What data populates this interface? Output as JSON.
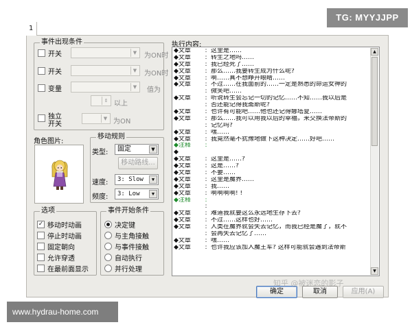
{
  "tabs": [
    "1"
  ],
  "conditions": {
    "title": "事件出现条件",
    "switch1": {
      "label": "开关",
      "suffix": "为ON时"
    },
    "switch2": {
      "label": "开关",
      "suffix": "为ON时"
    },
    "variable": {
      "label": "变量",
      "suffix": "值为",
      "above": "以上"
    },
    "selfswitch": {
      "label_line1": "独立",
      "label_line2": "开关",
      "suffix": "为ON"
    }
  },
  "avatar": {
    "label": "角色图片:"
  },
  "movement": {
    "title": "移动规则",
    "type_label": "类型:",
    "type_value": "固定",
    "route_button": "移动路线...",
    "speed_label": "速度:",
    "speed_value": "3: Slow",
    "freq_label": "频度:",
    "freq_value": "3: Low"
  },
  "options": {
    "title": "选项",
    "items": [
      {
        "label": "移动时动画",
        "checked": "✓"
      },
      {
        "label": "停止时动画",
        "checked": ""
      },
      {
        "label": "固定朝向",
        "checked": ""
      },
      {
        "label": "允许穿透",
        "checked": ""
      },
      {
        "label": "在最前面显示",
        "checked": ""
      }
    ]
  },
  "trigger": {
    "title": "事件开始条件",
    "items": [
      {
        "label": "决定键",
        "selected": true
      },
      {
        "label": "与主角接触",
        "selected": false
      },
      {
        "label": "与事件接触",
        "selected": false
      },
      {
        "label": "自动执行",
        "selected": false
      },
      {
        "label": "并行处理",
        "selected": false
      }
    ]
  },
  "exec": {
    "title": "执行内容:",
    "lines": [
      {
        "kw": "◆文章",
        "sep": ":",
        "text": "这里是……"
      },
      {
        "kw": "◆文章",
        "sep": ":",
        "text": "转生之地吗……"
      },
      {
        "kw": "◆文章",
        "sep": ":",
        "text": "我已经死了……"
      },
      {
        "kw": "◆文章",
        "sep": ":",
        "text": "那么……我要转生成为什么呢?"
      },
      {
        "kw": "◆文章",
        "sep": ":",
        "text": "啊……真不想睁开眼睛……"
      },
      {
        "kw": "◆文章",
        "sep": ":",
        "text": "不过……在我面前的……一定是熟悉的命运女神的"
      },
      {
        "kw": "",
        "sep": ":",
        "text": "微笑吧……",
        "cont": true
      },
      {
        "kw": "◆文章",
        "sep": ":",
        "text": "听说转生会忘记一切的记忆……不知……我以后是"
      },
      {
        "kw": "",
        "sep": ":",
        "text": "否还能记得我斋斯呢?",
        "cont": true
      },
      {
        "kw": "◆文章",
        "sep": ":",
        "text": "也许有可能吧……他也还记得娜塔夏……"
      },
      {
        "kw": "◆文章",
        "sep": ":",
        "text": "那么……我可以用我以后的幸福，来交换法帝斯的"
      },
      {
        "kw": "",
        "sep": ":",
        "text": "记忆吗?",
        "cont": true
      },
      {
        "kw": "◆文章",
        "sep": ":",
        "text": "嘿……"
      },
      {
        "kw": "◆文章",
        "sep": ":",
        "text": "我竟然毫不犹豫地做下这种决定……好吧……"
      },
      {
        "kw": "◆注释",
        "sep": ":",
        "text": "",
        "note": true
      },
      {
        "kw": "◆",
        "sep": "",
        "text": "",
        "empty": true
      },
      {
        "kw": "◆文章",
        "sep": ":",
        "text": "这里是……?"
      },
      {
        "kw": "◆文章",
        "sep": ":",
        "text": "这是……?"
      },
      {
        "kw": "◆文章",
        "sep": ":",
        "text": "不要……"
      },
      {
        "kw": "◆文章",
        "sep": ":",
        "text": "这里是魔界……"
      },
      {
        "kw": "◆文章",
        "sep": ":",
        "text": "我……"
      },
      {
        "kw": "◆文章",
        "sep": ":",
        "text": "啊啊啊啊! !"
      },
      {
        "kw": "◆注释",
        "sep": ":",
        "text": "",
        "note": true
      },
      {
        "kw": "",
        "sep": ":",
        "text": "",
        "cont": true
      },
      {
        "kw": "◆文章",
        "sep": ":",
        "text": "难道我就要这么永远地生存下去?"
      },
      {
        "kw": "◆文章",
        "sep": ":",
        "text": "不过……这样也好……"
      },
      {
        "kw": "◆文章",
        "sep": ":",
        "text": "人类在魔界就会失去记忆，而我已经是魔了，就不"
      },
      {
        "kw": "",
        "sep": ":",
        "text": "会再失去记忆了……",
        "cont": true
      },
      {
        "kw": "◆文章",
        "sep": ":",
        "text": "嘿……"
      },
      {
        "kw": "◆文章",
        "sep": ":",
        "text": "也许我应该加入魔王军? 这样可能就会遇到法帝斯"
      }
    ]
  },
  "buttons": {
    "ok": "确定",
    "cancel": "取消",
    "apply": "应用(A)"
  },
  "overlays": {
    "tg": "TG: MYYJJPP",
    "site": "www.hydrau-home.com",
    "zhihu": "知乎 @被迷恋的影子"
  }
}
